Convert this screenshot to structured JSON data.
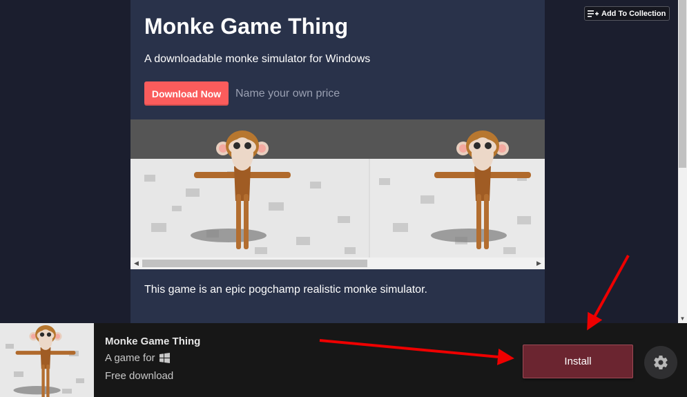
{
  "page": {
    "title": "Monke Game Thing",
    "subtitle": "A downloadable monke simulator for Windows",
    "download_button": "Download Now",
    "price_note": "Name your own price",
    "description": "This game is an epic pogchamp realistic monke simulator.",
    "collection_button": "Add To Collection"
  },
  "bottom_bar": {
    "game_name": "Monke Game Thing",
    "game_for": "A game for",
    "platform_icon": "windows-icon",
    "price": "Free download",
    "install_button": "Install",
    "settings_icon": "gear-icon"
  },
  "colors": {
    "accent": "#fa5c5c",
    "card_bg": "#29324a",
    "page_bg": "#1b1e2e",
    "install_bg": "#6b2530",
    "annotation_arrow": "#ee0000"
  }
}
